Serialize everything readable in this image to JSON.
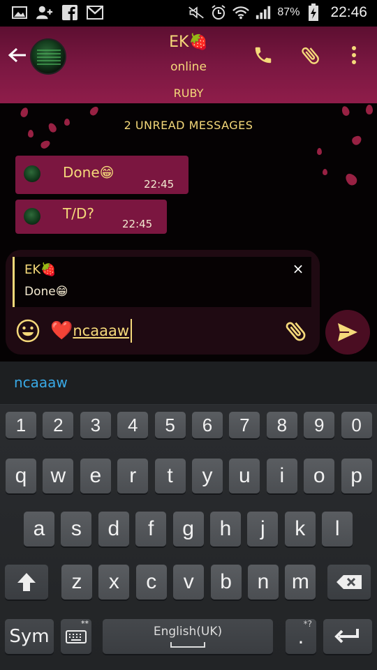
{
  "status_bar": {
    "battery_percent": "87%",
    "time": "22:46",
    "left_icons": [
      "image-icon",
      "add-person-icon",
      "facebook-icon",
      "gmail-icon"
    ],
    "right_icons": [
      "mute-icon",
      "alarm-icon",
      "wifi-icon",
      "signal-icon",
      "battery-charging-icon"
    ]
  },
  "header": {
    "contact_name": "EK🍓",
    "status": "online",
    "subtitle": "RUBY",
    "accent": "#f5d97a",
    "background": "#7a1741"
  },
  "chat": {
    "unread_banner": "2 UNREAD MESSAGES",
    "messages": [
      {
        "text": "Done😁",
        "time": "22:45"
      },
      {
        "text": "T/D?",
        "time": "22:45"
      }
    ]
  },
  "composer": {
    "reply_name": "EK🍓",
    "reply_text": "Done😁",
    "close_glyph": "×",
    "input_prefix": "❤️",
    "input_value": "ncaaaw"
  },
  "keyboard": {
    "suggestion": "ncaaaw",
    "numbers": [
      "1",
      "2",
      "3",
      "4",
      "5",
      "6",
      "7",
      "8",
      "9",
      "0"
    ],
    "row1": [
      "q",
      "w",
      "e",
      "r",
      "t",
      "y",
      "u",
      "i",
      "o",
      "p"
    ],
    "row2": [
      "a",
      "s",
      "d",
      "f",
      "g",
      "h",
      "j",
      "k",
      "l"
    ],
    "row3": [
      "z",
      "x",
      "c",
      "v",
      "b",
      "n",
      "m"
    ],
    "sym": "Sym",
    "space_label": "English(UK)",
    "period": ".",
    "period_hint": "*?",
    "settings_hint": "**"
  }
}
